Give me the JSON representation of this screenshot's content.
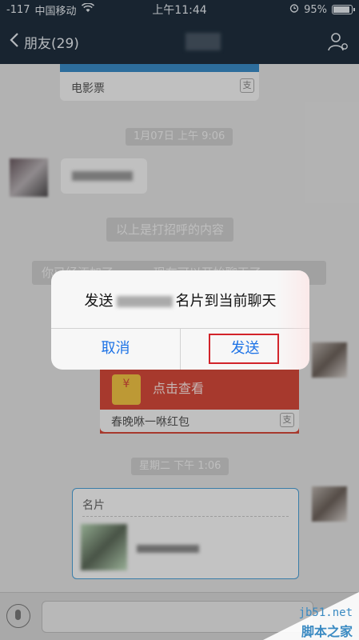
{
  "status": {
    "signal": "-117",
    "carrier": "中国移动",
    "time": "上午11:44",
    "battery": "95%",
    "battery_level": 0.95
  },
  "nav": {
    "back_label": "朋友(29)"
  },
  "chat": {
    "card_label": "电影票",
    "card_icon": "支",
    "time_1": "1月07日 上午 9:06",
    "system_msg": "以上是打招呼的内容",
    "system_msg_partial": "你已经添加了 　　　现在可以开始聊天了",
    "redpacket_text": "点击查看",
    "redpacket_label": "春晚咻一咻红包",
    "time_2": "星期二 下午 1:06",
    "namecard_label": "名片"
  },
  "dialog": {
    "message_pre": "发送",
    "message_post": "名片到当前聊天",
    "cancel_label": "取消",
    "send_label": "发送"
  },
  "watermark": {
    "site": "jb51.net",
    "brand": "脚本之家"
  },
  "colors": {
    "accent": "#1e73e6",
    "highlight_box": "#d2232a",
    "redpacket": "#d64a3a"
  }
}
